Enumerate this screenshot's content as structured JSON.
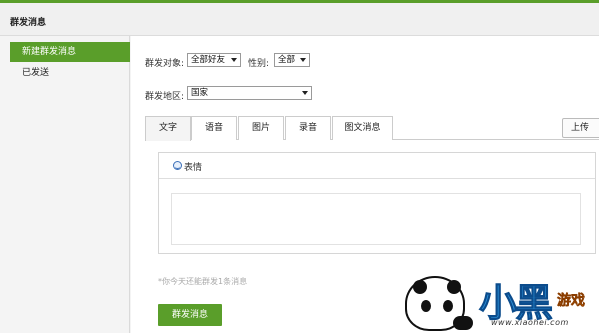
{
  "header": {
    "title": "群发消息"
  },
  "sidebar": {
    "items": [
      {
        "label": "新建群发消息",
        "active": true
      },
      {
        "label": "已发送",
        "active": false
      }
    ]
  },
  "filters": {
    "target_label": "群发对象:",
    "target_value": "全部好友",
    "gender_label": "性别:",
    "gender_value": "全部",
    "region_label": "群发地区:",
    "region_value": "国家"
  },
  "tabs": [
    {
      "label": "文字",
      "active": true
    },
    {
      "label": "语音",
      "active": false
    },
    {
      "label": "图片",
      "active": false
    },
    {
      "label": "录音",
      "active": false
    },
    {
      "label": "图文消息",
      "active": false
    }
  ],
  "upload_label": "上传",
  "editor": {
    "emoji_label": "表情"
  },
  "hint": "*你今天还能群发1条消息",
  "send_label": "群发消息",
  "watermark": {
    "brand_big": "小黑",
    "brand_small": "游戏",
    "url": "www.xiaohei.com"
  },
  "colors": {
    "accent": "#5a9e2a",
    "border": "#cccccc",
    "hint": "#aaaaaa"
  }
}
